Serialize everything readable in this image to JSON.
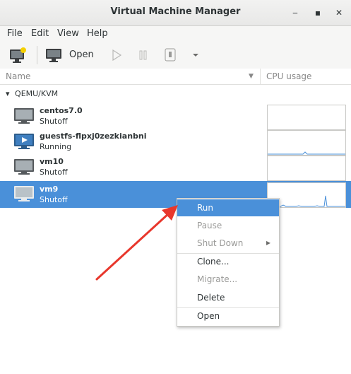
{
  "window": {
    "title": "Virtual Machine Manager",
    "minimize": "‒",
    "maximize": "▪",
    "close": "✕"
  },
  "menu": [
    "File",
    "Edit",
    "View",
    "Help"
  ],
  "toolbar": {
    "open_label": "Open"
  },
  "columns": {
    "name": "Name",
    "cpu": "CPU usage"
  },
  "group": {
    "arrow": "▾",
    "label": "QEMU/KVM"
  },
  "vms": [
    {
      "name": "centos7.0",
      "status": "Shutoff",
      "running": false,
      "selected": false
    },
    {
      "name": "guestfs-flpxj0zezkianbni",
      "status": "Running",
      "running": true,
      "selected": false
    },
    {
      "name": "vm10",
      "status": "Shutoff",
      "running": false,
      "selected": false
    },
    {
      "name": "vm9",
      "status": "Shutoff",
      "running": false,
      "selected": true
    }
  ],
  "context_menu": {
    "items": [
      {
        "label": "Run",
        "state": "highlighted"
      },
      {
        "label": "Pause",
        "state": "disabled"
      },
      {
        "label": "Shut Down",
        "state": "disabled",
        "submenu": "▸"
      },
      {
        "label": "Clone...",
        "state": "enabled"
      },
      {
        "label": "Migrate...",
        "state": "disabled"
      },
      {
        "label": "Delete",
        "state": "enabled"
      },
      {
        "label": "Open",
        "state": "enabled"
      }
    ]
  },
  "colors": {
    "selection": "#4a90d9",
    "annotation_arrow": "#e8372c"
  }
}
